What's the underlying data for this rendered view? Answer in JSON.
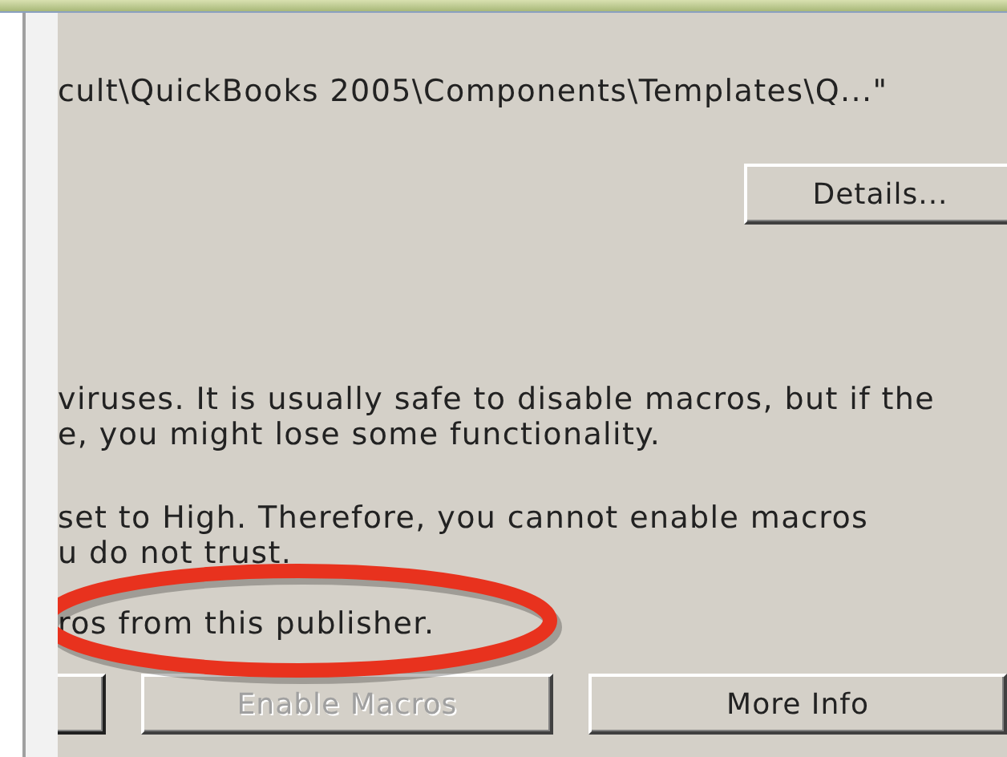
{
  "path_line": "cult\\QuickBooks 2005\\Components\\Templates\\Q...\"",
  "details_button": {
    "label": "Details...",
    "disabled": false
  },
  "paragraphs": [
    {
      "lines": [
        "viruses. It is usually safe to disable macros, but if the",
        "e, you might lose some functionality."
      ]
    },
    {
      "lines": [
        "set to High.  Therefore, you cannot enable macros",
        "u do not trust."
      ]
    },
    {
      "lines": [
        "ros from this publisher."
      ]
    }
  ],
  "buttons": [
    {
      "kind": "cut"
    },
    {
      "kind": "full",
      "label": "Enable Macros",
      "disabled": true
    },
    {
      "kind": "full",
      "label": "More Info",
      "disabled": false
    }
  ],
  "annotation": {
    "kind": "ellipse",
    "color": "#e8321e"
  }
}
